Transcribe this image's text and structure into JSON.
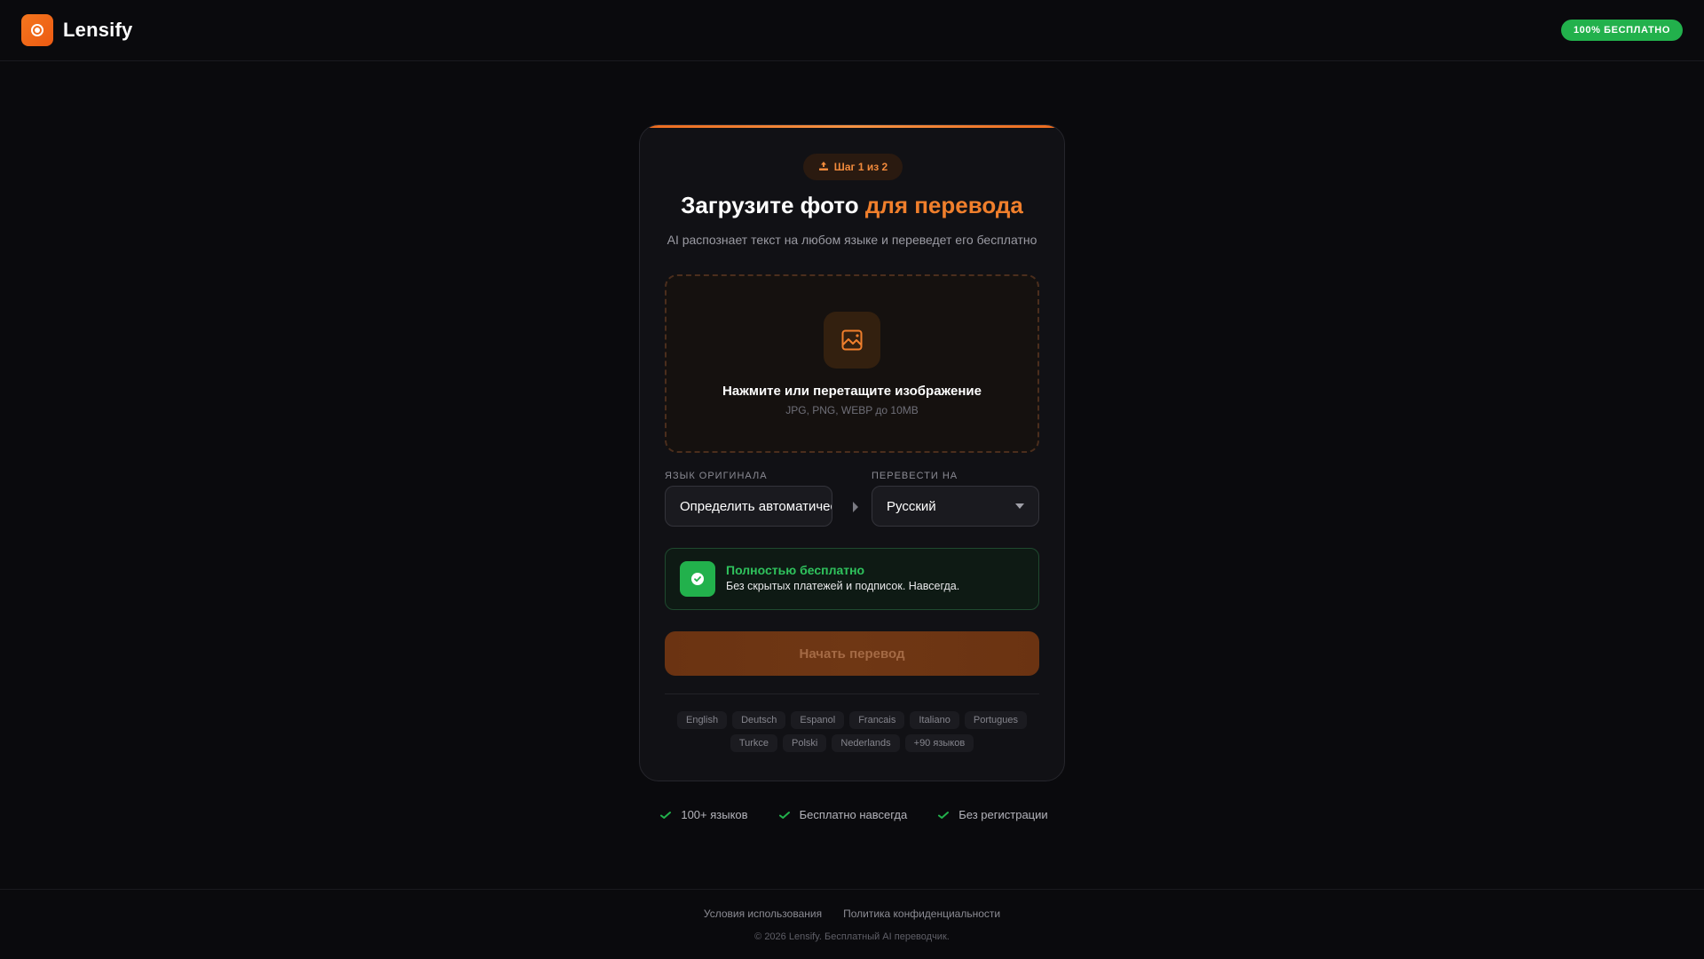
{
  "header": {
    "brand_name": "Lensify",
    "badge": "100% БЕСПЛАТНО"
  },
  "card": {
    "step_badge": "Шаг 1 из 2",
    "title_main": "Загрузите фото ",
    "title_accent": "для перевода",
    "subtitle": "AI распознает текст на любом языке и переведет его бесплатно",
    "dropzone": {
      "title": "Нажмите или перетащите изображение",
      "hint": "JPG, PNG, WEBP до 10MB"
    },
    "source_label": "ЯЗЫК ОРИГИНАЛА",
    "source_value": "Определить автоматически",
    "target_label": "ПЕРЕВЕСТИ НА",
    "target_value": "Русский",
    "free_notice": {
      "title": "Полностью бесплатно",
      "text": "Без скрытых платежей и подписок. Навсегда."
    },
    "start_button": "Начать перевод",
    "languages": [
      "English",
      "Deutsch",
      "Espanol",
      "Francais",
      "Italiano",
      "Portugues",
      "Turkce",
      "Polski",
      "Nederlands",
      "+90 языков"
    ]
  },
  "features": [
    "100+ языков",
    "Бесплатно навсегда",
    "Без регистрации"
  ],
  "footer": {
    "terms": "Условия использования",
    "privacy": "Политика конфиденциальности",
    "copyright": "© 2026 Lensify. Бесплатный AI переводчик."
  },
  "colors": {
    "accent": "#f07f2c",
    "success": "#22b14c",
    "background": "#0a0a0d"
  }
}
